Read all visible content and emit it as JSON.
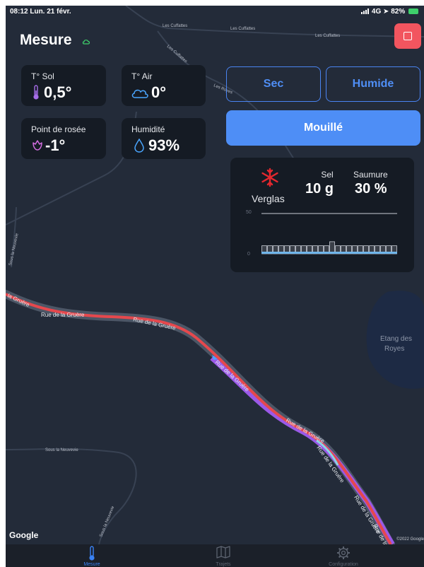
{
  "status": {
    "time_date": "08:12  Lun. 21 févr.",
    "network": "4G",
    "battery": "82%"
  },
  "app": {
    "title": "Mesure"
  },
  "tiles": {
    "ground": {
      "label": "T° Sol",
      "value": "0,5°"
    },
    "air": {
      "label": "T° Air",
      "value": "0°"
    },
    "dew": {
      "label": "Point de rosée",
      "value": "-1°"
    },
    "humidity": {
      "label": "Humidité",
      "value": "93%"
    }
  },
  "conditions": {
    "dry": "Sec",
    "wet": "Humide",
    "soaked": "Mouillé",
    "selected": "Mouillé"
  },
  "treatment": {
    "mode": "Verglas",
    "salt_label": "Sel",
    "salt_value": "10 g",
    "brine_label": "Saumure",
    "brine_value": "30 %",
    "chart_y_max": "50",
    "chart_y_min": "0"
  },
  "chart_data": {
    "type": "bar",
    "ylim": [
      0,
      50
    ],
    "values": [
      10,
      10,
      10,
      10,
      10,
      10,
      10,
      10,
      10,
      10,
      10,
      10,
      15,
      10,
      10,
      10,
      10,
      10,
      10,
      10,
      10,
      10,
      10,
      10
    ]
  },
  "map": {
    "labels": {
      "cuffattes_1": "Les Cuffattes",
      "cuffattes_2": "Les Cuffattes",
      "cuffattes_3": "Les Cuffattes",
      "cuffattes_diag": "Les Cuffattes",
      "royes_road": "Les Royes",
      "neuvevie_left": "Sous la Neuvevie",
      "neuvevie_low": "Sous la Neuvevie",
      "neuvevie_vertical": "Sous la Neuvevie",
      "gruere_1": "la Gruère",
      "gruere_2": "Rue de la Gruère",
      "gruere_3": "Rue de la Gruère",
      "gruere_4": "Rue de la Gruère",
      "gruere_5": "Rue de la Gruère",
      "gruere_6": "Rue de la Gruère",
      "gruere_7": "Rue de la Gruère",
      "gruere_8": "Rue de la Gruère",
      "etang_1": "Etang des",
      "etang_2": "Royes"
    },
    "google": "Google",
    "copyright": "©2022 Google"
  },
  "tabs": [
    {
      "label": "Mesure",
      "icon": "thermometer-icon"
    },
    {
      "label": "Trajets",
      "icon": "map-icon"
    },
    {
      "label": "Configuration",
      "icon": "gear-icon"
    }
  ],
  "colors": {
    "accent": "#4e8ef6",
    "stop": "#f2555f",
    "route_red": "#e5484d",
    "route_purple": "#9b59e8",
    "snow": "#e5282f"
  }
}
